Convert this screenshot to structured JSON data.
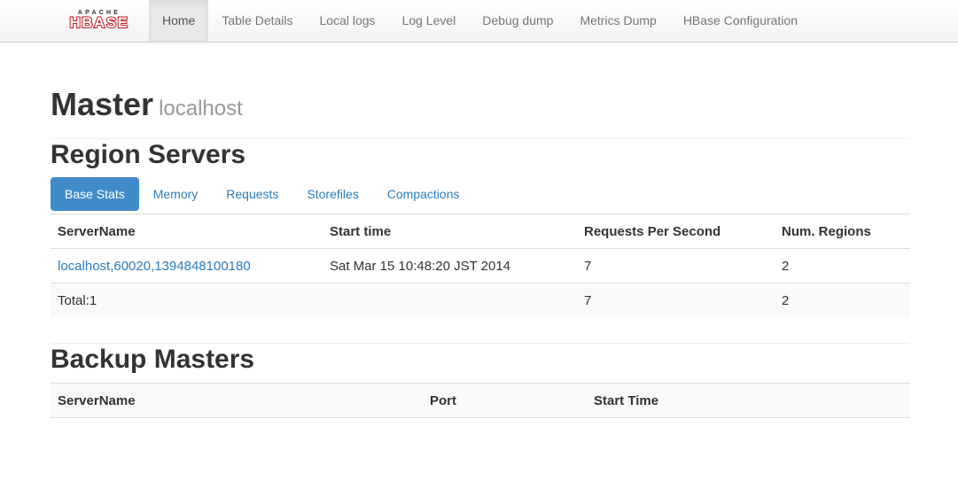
{
  "brand": {
    "small": "APACHE",
    "big": "HBASE"
  },
  "nav": {
    "items": [
      {
        "label": "Home",
        "active": true
      },
      {
        "label": "Table Details"
      },
      {
        "label": "Local logs"
      },
      {
        "label": "Log Level"
      },
      {
        "label": "Debug dump"
      },
      {
        "label": "Metrics Dump"
      },
      {
        "label": "HBase Configuration"
      }
    ]
  },
  "header": {
    "title": "Master",
    "subtitle": "localhost"
  },
  "region_servers": {
    "title": "Region Servers",
    "tabs": [
      {
        "label": "Base Stats",
        "active": true
      },
      {
        "label": "Memory"
      },
      {
        "label": "Requests"
      },
      {
        "label": "Storefiles"
      },
      {
        "label": "Compactions"
      }
    ],
    "columns": [
      "ServerName",
      "Start time",
      "Requests Per Second",
      "Num. Regions"
    ],
    "rows": [
      {
        "server": "localhost,60020,1394848100180",
        "start_time": "Sat Mar 15 10:48:20 JST 2014",
        "rps": "7",
        "regions": "2"
      }
    ],
    "total": {
      "label": "Total:1",
      "rps": "7",
      "regions": "2"
    }
  },
  "backup_masters": {
    "title": "Backup Masters",
    "columns": [
      "ServerName",
      "Port",
      "Start Time"
    ]
  },
  "colors": {
    "brand_red": "#c4151c",
    "link": "#2a7bbd",
    "active_tab": "#428bca"
  }
}
